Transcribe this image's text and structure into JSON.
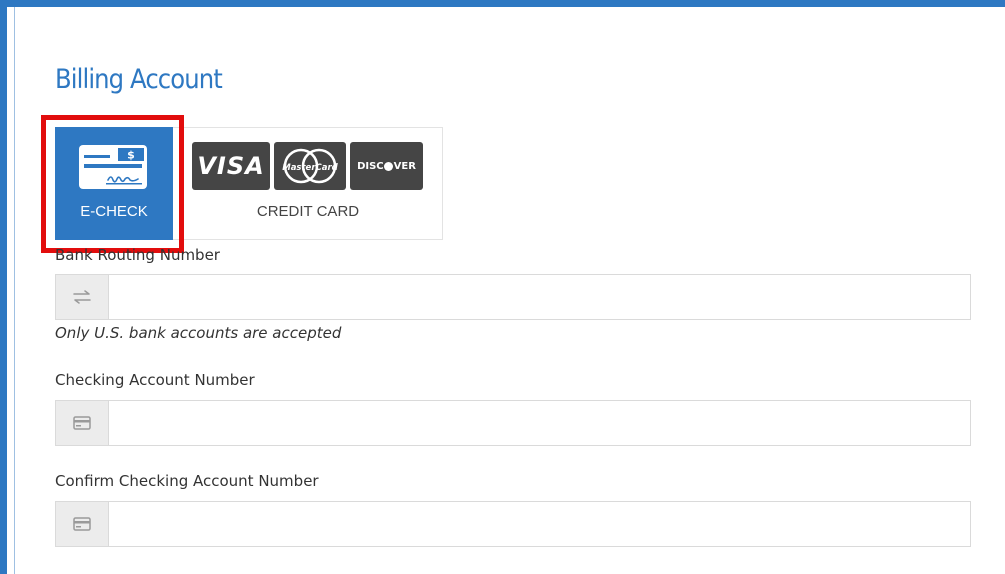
{
  "form": {
    "title": "Billing Account",
    "payment_methods": {
      "echeck_label": "E-CHECK",
      "credit_label": "CREDIT CARD",
      "check_icon_symbol": "$",
      "cards": {
        "visa": "VISA",
        "mastercard": "MasterCard",
        "discover_pre": "DISC",
        "discover_post": "VER"
      }
    },
    "fields": {
      "routing": {
        "label": "Bank Routing Number",
        "value": "",
        "icon": "transfer-arrows-icon",
        "hint": "Only U.S. bank accounts are accepted"
      },
      "checking": {
        "label": "Checking Account Number",
        "value": "",
        "icon": "card-icon"
      },
      "confirm": {
        "label": "Confirm Checking Account Number",
        "value": "",
        "icon": "card-icon"
      }
    },
    "colors": {
      "accent": "#2e78c2",
      "highlight": "#e20d0d"
    }
  }
}
